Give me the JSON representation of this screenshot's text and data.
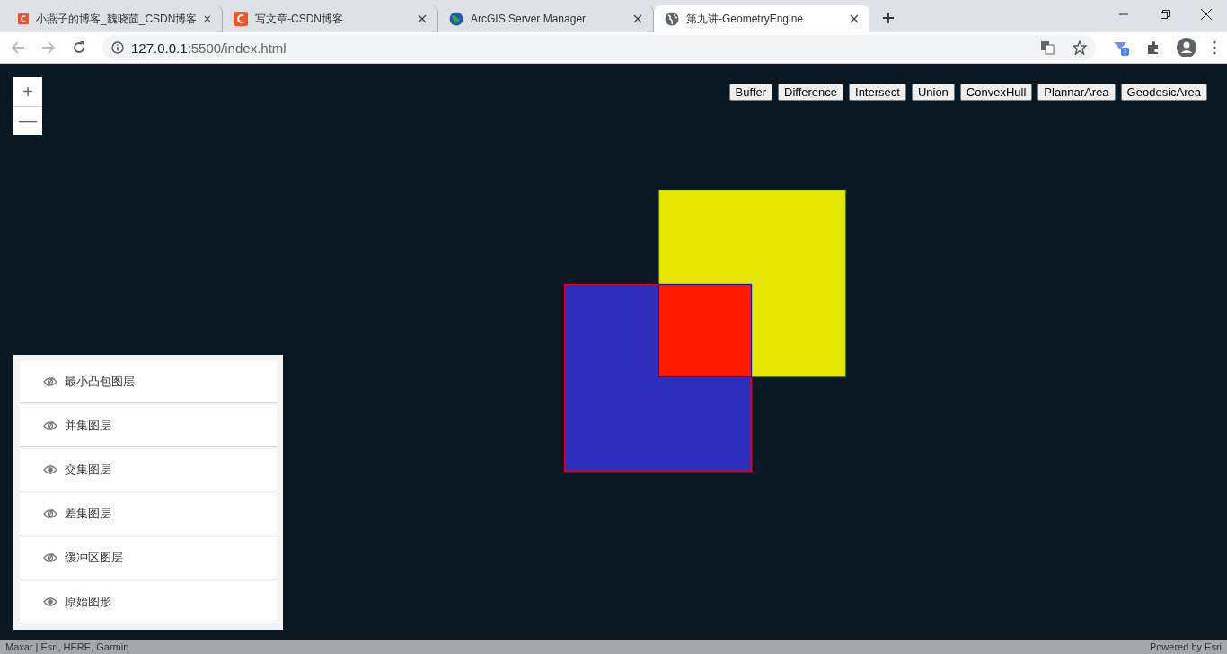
{
  "browser": {
    "tabs": [
      {
        "title": "小燕子的博客_魏晓茴_CSDN博客",
        "kind": "csdn",
        "selected": false
      },
      {
        "title": "写文章-CSDN博客",
        "kind": "csdn",
        "selected": false
      },
      {
        "title": "ArcGIS Server Manager",
        "kind": "arcgis",
        "selected": false
      },
      {
        "title": "第九讲-GeometryEngine",
        "kind": "web",
        "selected": true
      }
    ],
    "address": {
      "host": "127.0.0.1",
      "rest": ":5500/index.html"
    }
  },
  "map": {
    "zoom_buttons": [
      "+",
      "—"
    ],
    "tools": [
      "Buffer",
      "Difference",
      "Intersect",
      "Union",
      "ConvexHull",
      "PlannarArea",
      "GeodesicArea"
    ],
    "graphics": [
      {
        "kind": "square-upper",
        "color": "#e6e600"
      },
      {
        "kind": "square-lower",
        "color": "#2e2ebd"
      },
      {
        "kind": "overlap",
        "color": "#ff1a00"
      }
    ],
    "layers": [
      {
        "label": "最小凸包图层",
        "visible": false
      },
      {
        "label": "并集图层",
        "visible": false
      },
      {
        "label": "交集图层",
        "visible": true
      },
      {
        "label": "差集图层",
        "visible": false
      },
      {
        "label": "缓冲区图层",
        "visible": false
      },
      {
        "label": "原始图形",
        "visible": true
      }
    ],
    "attribution": "Maxar | Esri, HERE, Garmin",
    "powered_by": "Powered by Esri"
  }
}
